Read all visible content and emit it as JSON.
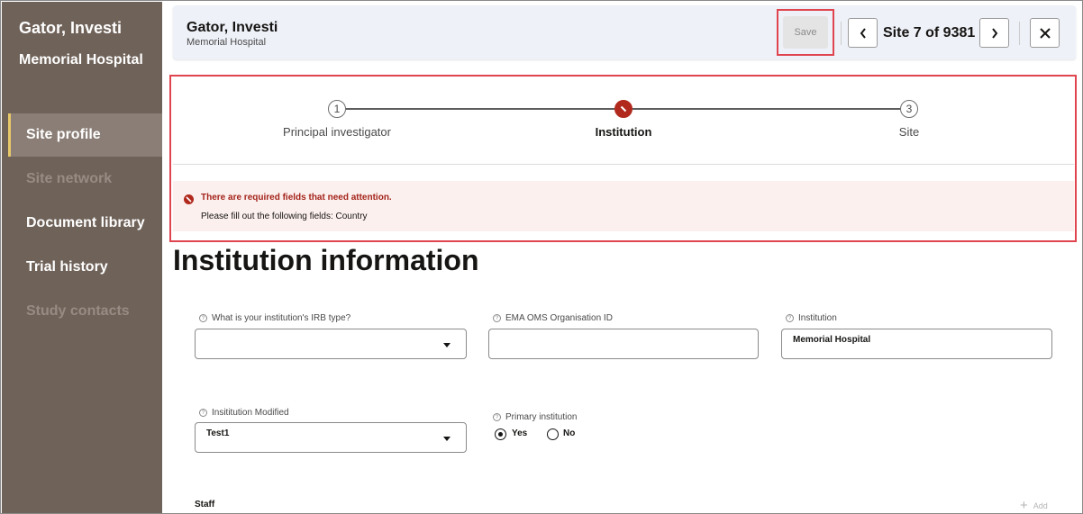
{
  "sidebar": {
    "investigator_name": "Gator, Investi",
    "institution_name": "Memorial Hospital",
    "items": [
      {
        "label": "Site profile",
        "state": "active"
      },
      {
        "label": "Site network",
        "state": "disabled"
      },
      {
        "label": "Document library",
        "state": "normal"
      },
      {
        "label": "Trial history",
        "state": "normal"
      },
      {
        "label": "Study contacts",
        "state": "disabled"
      }
    ]
  },
  "header": {
    "title": "Gator, Investi",
    "subtitle": "Memorial Hospital",
    "save_label": "Save",
    "site_counter": "Site 7 of 9381",
    "prev_icon": "chevron-left-icon",
    "next_icon": "chevron-right-icon",
    "close_icon": "close-icon"
  },
  "train": {
    "steps": [
      {
        "number": "1",
        "label": "Principal investigator",
        "status": "visited"
      },
      {
        "number": "",
        "label": "Institution",
        "status": "error-current"
      },
      {
        "number": "3",
        "label": "Site",
        "status": "unvisited"
      }
    ]
  },
  "alert": {
    "title": "There are required fields that need attention.",
    "message": "Please fill out the following fields: Country"
  },
  "page_title": "Institution information",
  "form": {
    "irb_type": {
      "label": "What is your institution's IRB type?",
      "value": ""
    },
    "ema_oms_id": {
      "label": "EMA OMS Organisation ID",
      "value": ""
    },
    "institution": {
      "label": "Institution",
      "value": "Memorial Hospital"
    },
    "institution_modified": {
      "label": "Insititution Modified",
      "value": "Test1"
    },
    "primary_institution": {
      "label": "Primary institution",
      "options": [
        "Yes",
        "No"
      ],
      "selected": "Yes"
    }
  },
  "staff": {
    "label": "Staff",
    "add_label": "Add"
  },
  "colors": {
    "sidebar_bg": "#6f6259",
    "active_indicator": "#e8c96a",
    "error_red": "#b1291d",
    "highlight_red": "#e0454f"
  }
}
